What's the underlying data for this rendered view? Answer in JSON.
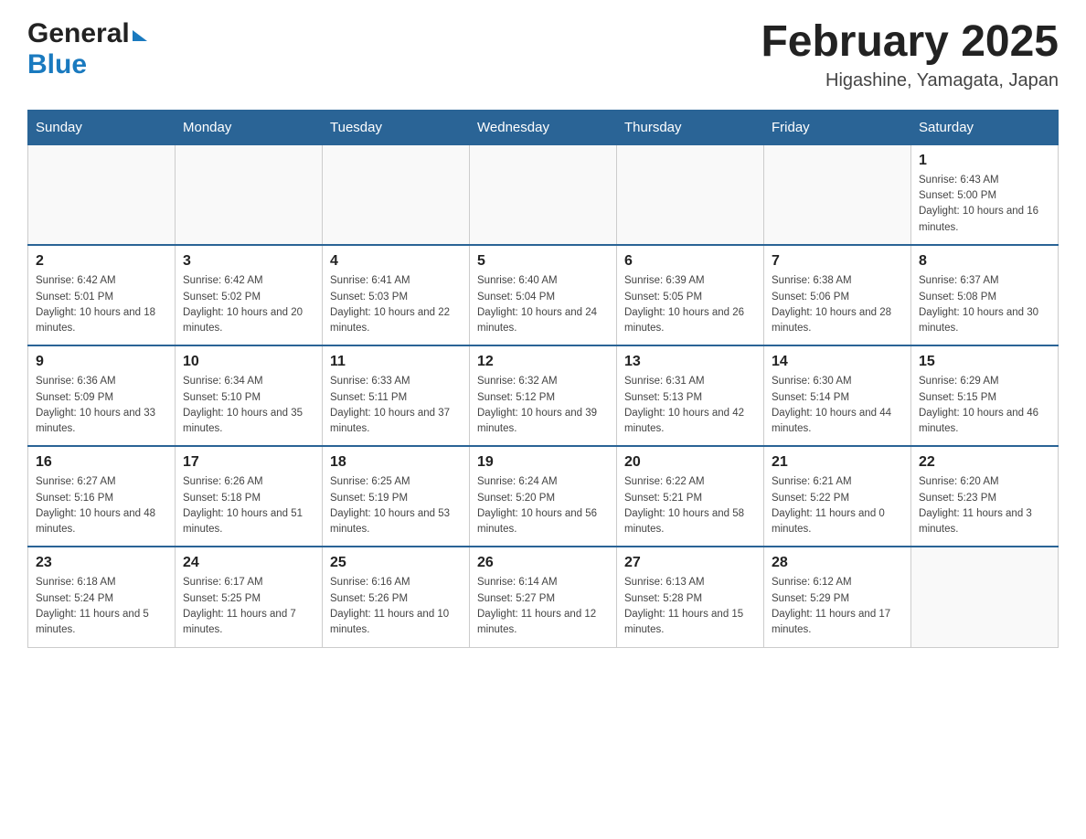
{
  "header": {
    "logo_general": "General",
    "logo_blue": "Blue",
    "month_title": "February 2025",
    "location": "Higashine, Yamagata, Japan"
  },
  "days": [
    "Sunday",
    "Monday",
    "Tuesday",
    "Wednesday",
    "Thursday",
    "Friday",
    "Saturday"
  ],
  "weeks": [
    [
      {
        "day": "",
        "sunrise": "",
        "sunset": "",
        "daylight": ""
      },
      {
        "day": "",
        "sunrise": "",
        "sunset": "",
        "daylight": ""
      },
      {
        "day": "",
        "sunrise": "",
        "sunset": "",
        "daylight": ""
      },
      {
        "day": "",
        "sunrise": "",
        "sunset": "",
        "daylight": ""
      },
      {
        "day": "",
        "sunrise": "",
        "sunset": "",
        "daylight": ""
      },
      {
        "day": "",
        "sunrise": "",
        "sunset": "",
        "daylight": ""
      },
      {
        "day": "1",
        "sunrise": "Sunrise: 6:43 AM",
        "sunset": "Sunset: 5:00 PM",
        "daylight": "Daylight: 10 hours and 16 minutes."
      }
    ],
    [
      {
        "day": "2",
        "sunrise": "Sunrise: 6:42 AM",
        "sunset": "Sunset: 5:01 PM",
        "daylight": "Daylight: 10 hours and 18 minutes."
      },
      {
        "day": "3",
        "sunrise": "Sunrise: 6:42 AM",
        "sunset": "Sunset: 5:02 PM",
        "daylight": "Daylight: 10 hours and 20 minutes."
      },
      {
        "day": "4",
        "sunrise": "Sunrise: 6:41 AM",
        "sunset": "Sunset: 5:03 PM",
        "daylight": "Daylight: 10 hours and 22 minutes."
      },
      {
        "day": "5",
        "sunrise": "Sunrise: 6:40 AM",
        "sunset": "Sunset: 5:04 PM",
        "daylight": "Daylight: 10 hours and 24 minutes."
      },
      {
        "day": "6",
        "sunrise": "Sunrise: 6:39 AM",
        "sunset": "Sunset: 5:05 PM",
        "daylight": "Daylight: 10 hours and 26 minutes."
      },
      {
        "day": "7",
        "sunrise": "Sunrise: 6:38 AM",
        "sunset": "Sunset: 5:06 PM",
        "daylight": "Daylight: 10 hours and 28 minutes."
      },
      {
        "day": "8",
        "sunrise": "Sunrise: 6:37 AM",
        "sunset": "Sunset: 5:08 PM",
        "daylight": "Daylight: 10 hours and 30 minutes."
      }
    ],
    [
      {
        "day": "9",
        "sunrise": "Sunrise: 6:36 AM",
        "sunset": "Sunset: 5:09 PM",
        "daylight": "Daylight: 10 hours and 33 minutes."
      },
      {
        "day": "10",
        "sunrise": "Sunrise: 6:34 AM",
        "sunset": "Sunset: 5:10 PM",
        "daylight": "Daylight: 10 hours and 35 minutes."
      },
      {
        "day": "11",
        "sunrise": "Sunrise: 6:33 AM",
        "sunset": "Sunset: 5:11 PM",
        "daylight": "Daylight: 10 hours and 37 minutes."
      },
      {
        "day": "12",
        "sunrise": "Sunrise: 6:32 AM",
        "sunset": "Sunset: 5:12 PM",
        "daylight": "Daylight: 10 hours and 39 minutes."
      },
      {
        "day": "13",
        "sunrise": "Sunrise: 6:31 AM",
        "sunset": "Sunset: 5:13 PM",
        "daylight": "Daylight: 10 hours and 42 minutes."
      },
      {
        "day": "14",
        "sunrise": "Sunrise: 6:30 AM",
        "sunset": "Sunset: 5:14 PM",
        "daylight": "Daylight: 10 hours and 44 minutes."
      },
      {
        "day": "15",
        "sunrise": "Sunrise: 6:29 AM",
        "sunset": "Sunset: 5:15 PM",
        "daylight": "Daylight: 10 hours and 46 minutes."
      }
    ],
    [
      {
        "day": "16",
        "sunrise": "Sunrise: 6:27 AM",
        "sunset": "Sunset: 5:16 PM",
        "daylight": "Daylight: 10 hours and 48 minutes."
      },
      {
        "day": "17",
        "sunrise": "Sunrise: 6:26 AM",
        "sunset": "Sunset: 5:18 PM",
        "daylight": "Daylight: 10 hours and 51 minutes."
      },
      {
        "day": "18",
        "sunrise": "Sunrise: 6:25 AM",
        "sunset": "Sunset: 5:19 PM",
        "daylight": "Daylight: 10 hours and 53 minutes."
      },
      {
        "day": "19",
        "sunrise": "Sunrise: 6:24 AM",
        "sunset": "Sunset: 5:20 PM",
        "daylight": "Daylight: 10 hours and 56 minutes."
      },
      {
        "day": "20",
        "sunrise": "Sunrise: 6:22 AM",
        "sunset": "Sunset: 5:21 PM",
        "daylight": "Daylight: 10 hours and 58 minutes."
      },
      {
        "day": "21",
        "sunrise": "Sunrise: 6:21 AM",
        "sunset": "Sunset: 5:22 PM",
        "daylight": "Daylight: 11 hours and 0 minutes."
      },
      {
        "day": "22",
        "sunrise": "Sunrise: 6:20 AM",
        "sunset": "Sunset: 5:23 PM",
        "daylight": "Daylight: 11 hours and 3 minutes."
      }
    ],
    [
      {
        "day": "23",
        "sunrise": "Sunrise: 6:18 AM",
        "sunset": "Sunset: 5:24 PM",
        "daylight": "Daylight: 11 hours and 5 minutes."
      },
      {
        "day": "24",
        "sunrise": "Sunrise: 6:17 AM",
        "sunset": "Sunset: 5:25 PM",
        "daylight": "Daylight: 11 hours and 7 minutes."
      },
      {
        "day": "25",
        "sunrise": "Sunrise: 6:16 AM",
        "sunset": "Sunset: 5:26 PM",
        "daylight": "Daylight: 11 hours and 10 minutes."
      },
      {
        "day": "26",
        "sunrise": "Sunrise: 6:14 AM",
        "sunset": "Sunset: 5:27 PM",
        "daylight": "Daylight: 11 hours and 12 minutes."
      },
      {
        "day": "27",
        "sunrise": "Sunrise: 6:13 AM",
        "sunset": "Sunset: 5:28 PM",
        "daylight": "Daylight: 11 hours and 15 minutes."
      },
      {
        "day": "28",
        "sunrise": "Sunrise: 6:12 AM",
        "sunset": "Sunset: 5:29 PM",
        "daylight": "Daylight: 11 hours and 17 minutes."
      },
      {
        "day": "",
        "sunrise": "",
        "sunset": "",
        "daylight": ""
      }
    ]
  ]
}
